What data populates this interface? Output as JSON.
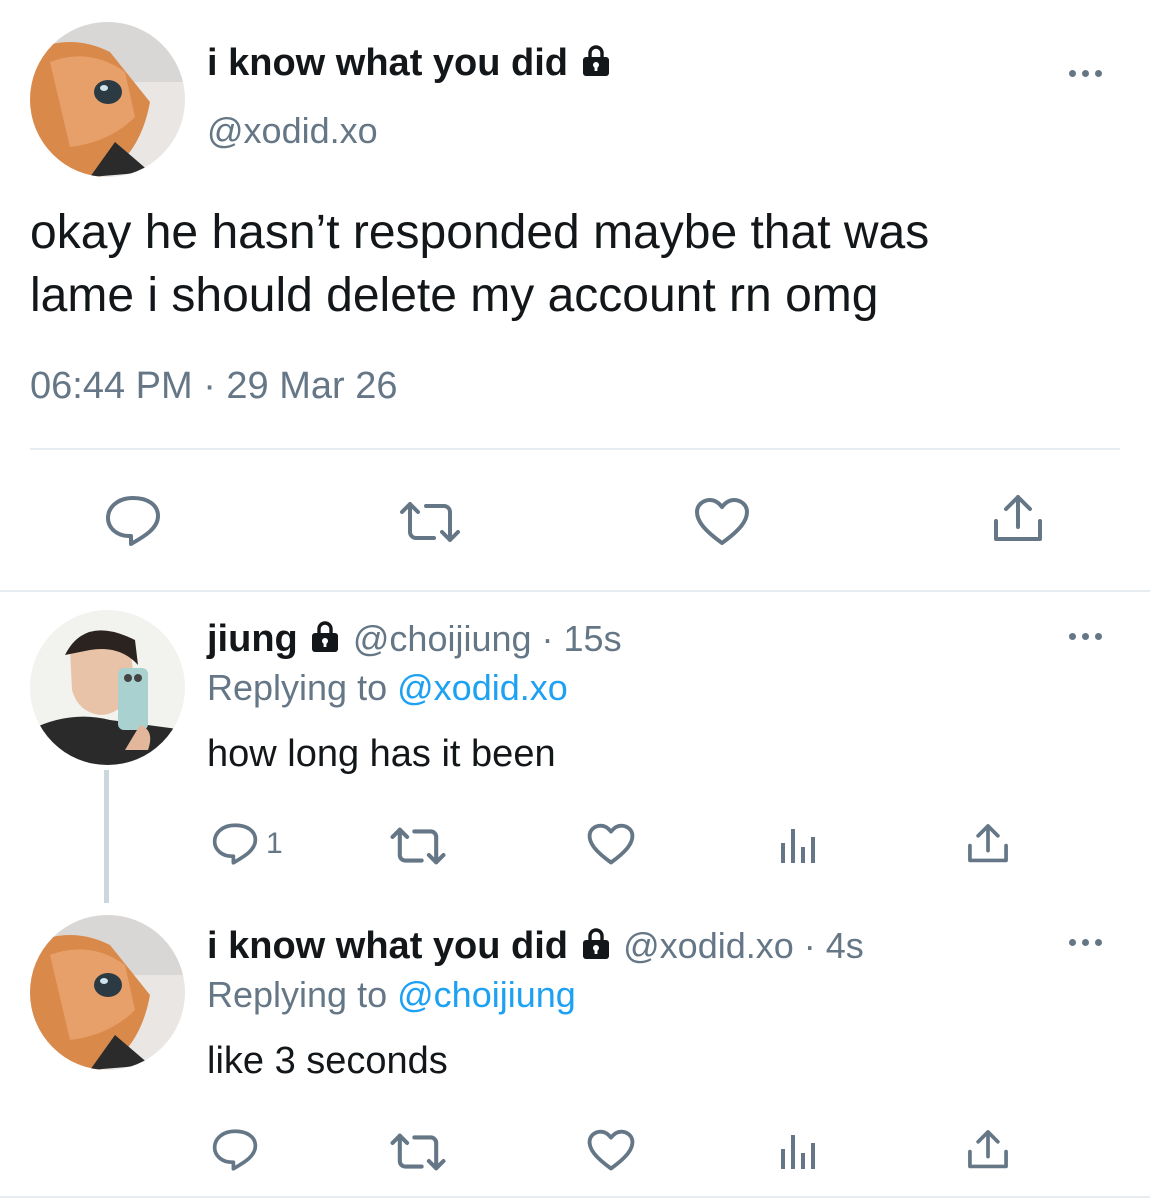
{
  "main_tweet": {
    "display_name": "i know what you did",
    "handle": "@xodid.xo",
    "text_line1": "okay he hasn’t responded maybe that was",
    "text_line2": "lame i should delete my account rn omg",
    "timestamp": "06:44 PM · 29 Mar 26"
  },
  "replies": [
    {
      "display_name": "jiung",
      "handle_time": "@choijiung · 15s",
      "replying_prefix": "Replying to",
      "replying_to": "@xodid.xo",
      "text": "how long has it been",
      "reply_count": "1"
    },
    {
      "display_name": "i know what you did",
      "handle_time": "@xodid.xo · 4s",
      "replying_prefix": "Replying to",
      "replying_to": "@choijiung",
      "text": "like 3 seconds",
      "reply_count": ""
    }
  ],
  "colors": {
    "accent": "#1da1f2",
    "muted": "#657786",
    "divider": "#e6ecf0"
  }
}
